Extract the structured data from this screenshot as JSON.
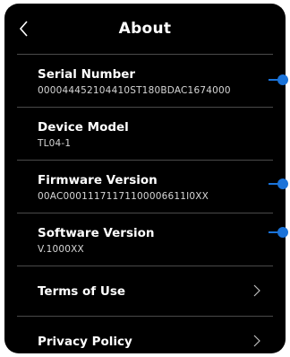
{
  "header": {
    "title": "About",
    "back_icon": "chevron-left-icon"
  },
  "info_rows": [
    {
      "label": "Serial Number",
      "value": "000044452104410ST180BDAC1674000"
    },
    {
      "label": "Device Model",
      "value": "TL04-1"
    },
    {
      "label": "Firmware Version",
      "value": "00AC00011171171100006611I0XX"
    },
    {
      "label": "Software Version",
      "value": "V.1000XX"
    }
  ],
  "link_rows": [
    {
      "label": "Terms of Use",
      "icon": "chevron-right-icon"
    },
    {
      "label": "Privacy Policy",
      "icon": "chevron-right-icon"
    }
  ],
  "colors": {
    "background": "#000000",
    "text": "#ffffff",
    "callout": "#1a73d9",
    "divider": "#4a4a4a"
  }
}
